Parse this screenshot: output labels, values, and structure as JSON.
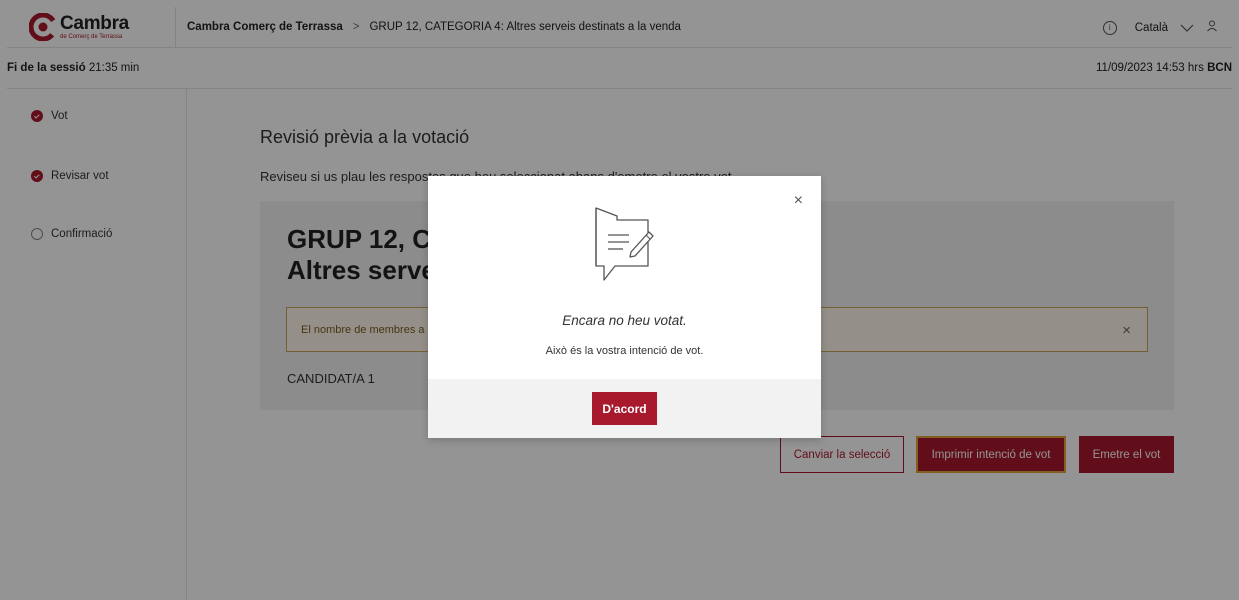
{
  "header": {
    "logo_title": "Cambra",
    "logo_subtitle": "de Comerç de Terrassa",
    "breadcrumb_home": "Cambra Comerç de Terrassa",
    "breadcrumb_separator": ">",
    "breadcrumb_current": "GRUP 12, CATEGORIA 4: Altres serveis destinats a la venda",
    "info_icon": "i",
    "language": "Català"
  },
  "session": {
    "end_label": "Fi de la sessió",
    "remaining": "21:35 min",
    "datetime": "11/09/2023 14:53 hrs",
    "timezone": "BCN"
  },
  "sidebar": {
    "steps": [
      {
        "label": "Vot",
        "status": "done"
      },
      {
        "label": "Revisar vot",
        "status": "done"
      },
      {
        "label": "Confirmació",
        "status": "pending"
      }
    ]
  },
  "main": {
    "title": "Revisió prèvia a la votació",
    "description": "Reviseu si us plau les respostes que heu seleccionat abans d'emetre el vostre vot.",
    "card": {
      "title_line1": "GRUP 12, CATEGORIA 4:",
      "title_line2": "Altres serveis destinats a la venda",
      "alert_text": "El nombre de membres a escollir no ha estat seleccionat.",
      "alert_close": "×",
      "candidate": "CANDIDAT/A 1"
    },
    "buttons": {
      "change": "Canviar la selecció",
      "print": "Imprimir intenció de vot",
      "emit": "Emetre el vot"
    }
  },
  "modal": {
    "close": "×",
    "title": "Encara no heu votat.",
    "text": "Això és la vostra intenció de vot.",
    "ok": "D'acord"
  },
  "colors": {
    "brand": "#a8192e",
    "warning_border": "#c9a45a"
  }
}
